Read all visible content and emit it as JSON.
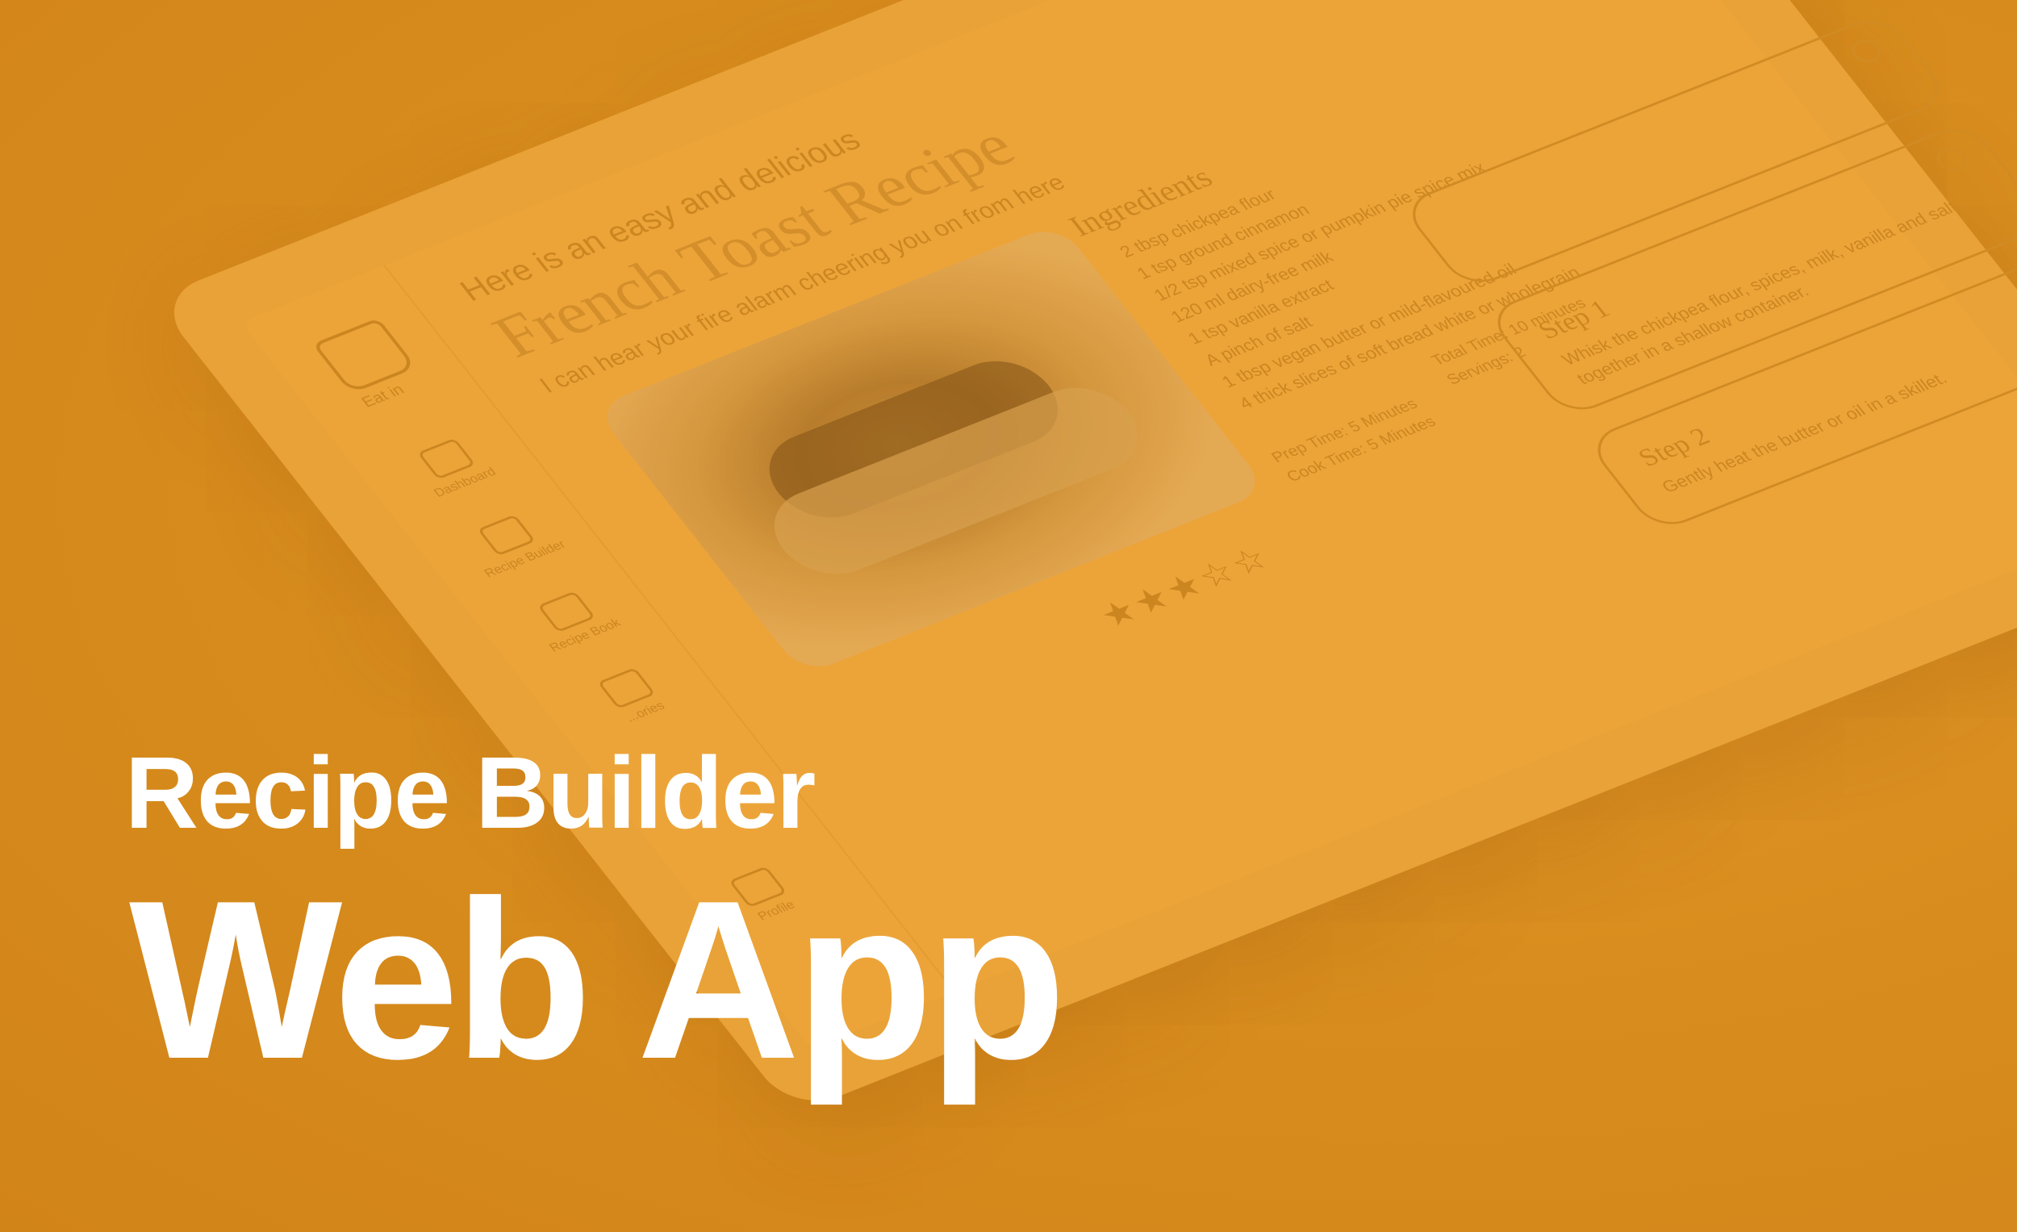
{
  "hero": {
    "line1": "Recipe Builder",
    "line2": "Web App"
  },
  "app": {
    "logo_text": "Eat in",
    "nav": [
      {
        "label": "Dashboard",
        "icon": "cloche-icon"
      },
      {
        "label": "Recipe Builder",
        "icon": "chef-hat-icon"
      },
      {
        "label": "Recipe Book",
        "icon": "book-icon"
      },
      {
        "label": "...ories",
        "icon": "list-icon"
      }
    ],
    "profile_label": "Profile",
    "intro": "Here is an easy and delicious",
    "recipe_title": "French Toast Recipe",
    "tagline": "I can hear your fire alarm cheering you on from here",
    "prep_time": "Prep Time: 5 Minutes",
    "cook_time": "Cook Time: 5 Minutes",
    "total_time": "Total Time: 10 minutes",
    "servings": "Servings: 2",
    "stars": "★★★☆☆",
    "ingredients_title": "Ingredients",
    "ingredients": [
      "2 tbsp chickpea flour",
      "1 tsp ground cinnamon",
      "1/2 tsp mixed spice or pumpkin pie spice mix",
      "120 ml dairy-free milk",
      "1 tsp vanilla extract",
      "A pinch of salt",
      "1 tbsp vegan butter or mild-flavoured oil",
      "4 thick slices of soft bread white or wholegrain"
    ],
    "steps": [
      {
        "title": "Step 1",
        "text": "Whisk the chickpea flour, spices, milk, vanilla and salt together in a shallow container."
      },
      {
        "title": "Step 2",
        "text": "Gently heat the butter or oil in a skillet."
      }
    ]
  },
  "colors": {
    "background": "#d58a1b",
    "tablet": "#eba83e",
    "title_text": "#ffffff"
  }
}
